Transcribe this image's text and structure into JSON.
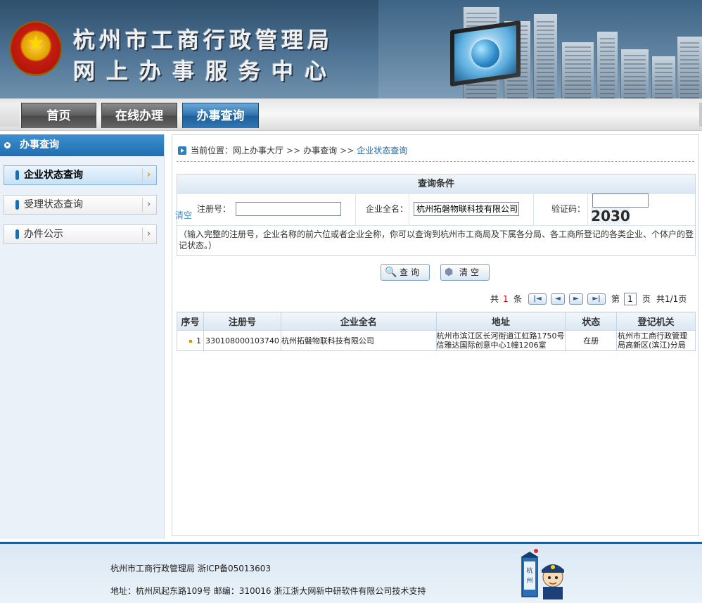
{
  "header": {
    "title_line1": "杭州市工商行政管理局",
    "title_line2": "网上办事服务中心"
  },
  "nav": {
    "tabs": [
      {
        "label": "首页",
        "active": false
      },
      {
        "label": "在线办理",
        "active": false
      },
      {
        "label": "办事查询",
        "active": true
      }
    ]
  },
  "sidebar": {
    "heading": "办事查询",
    "items": [
      {
        "label": "企业状态查询",
        "active": true
      },
      {
        "label": "受理状态查询",
        "active": false
      },
      {
        "label": "办件公示",
        "active": false
      }
    ]
  },
  "breadcrumb": {
    "prefix": "当前位置：",
    "items": [
      "网上办事大厅",
      "办事查询",
      "企业状态查询"
    ],
    "separator": ">>"
  },
  "query": {
    "heading": "查询条件",
    "clear_link": "清空",
    "reg_label": "注册号：",
    "reg_value": "",
    "name_label": "企业全名：",
    "name_value": "杭州拓磐物联科技有限公司",
    "captcha_label": "验证码：",
    "captcha_value": "",
    "captcha_image_text": "2030",
    "hint": "（输入完整的注册号，企业名称的前六位或者企业全称，你可以查询到杭州市工商局及下属各分局、各工商所登记的各类企业、个体户的登记状态。）"
  },
  "buttons": {
    "search": "查询",
    "clear": "清空"
  },
  "pager": {
    "total_prefix": "共",
    "total_count": "1",
    "total_suffix": "条",
    "page_prefix": "第",
    "page_value": "1",
    "page_suffix": "页",
    "page_info": "共1/1页"
  },
  "results": {
    "columns": [
      "序号",
      "注册号",
      "企业全名",
      "地址",
      "状态",
      "登记机关"
    ],
    "rows": [
      {
        "index": "1",
        "reg_no": "330108000103740",
        "name": "杭州拓磐物联科技有限公司",
        "address": "杭州市滨江区长河街道江虹路1750号信雅达国际创意中心1幢1206室",
        "status": "在册",
        "authority": "杭州市工商行政管理局高新区(滨江)分局"
      }
    ]
  },
  "footer": {
    "line1": "杭州市工商行政管理局 浙ICP备05013603",
    "line2": "地址：杭州凤起东路109号 邮编：310016 浙江浙大网新中研软件有限公司技术支持"
  },
  "colors": {
    "accent": "#1f6eb0",
    "nav_active": "#2d73b0",
    "nav_inactive": "#5e5e5e",
    "hint_link": "#3b8fd6",
    "count_red": "#cc0000"
  },
  "icons": {
    "emblem": "national-emblem-icon",
    "search": "magnifier-icon",
    "clear": "cube-icon",
    "mascot": "police-mascot-icon"
  }
}
